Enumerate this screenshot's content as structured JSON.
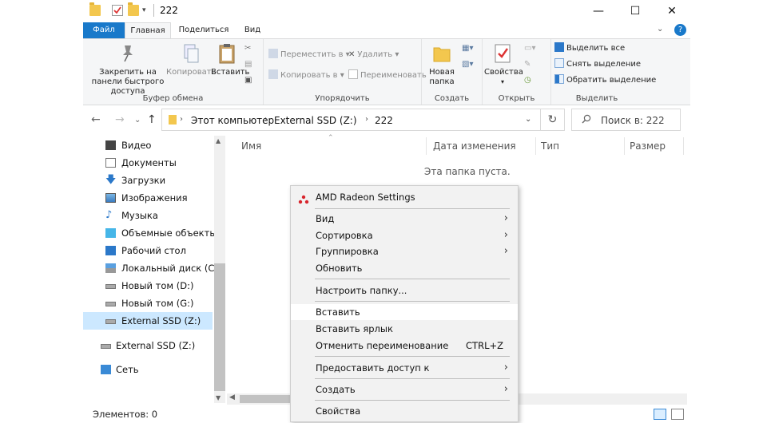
{
  "window": {
    "title": "222"
  },
  "ribbon_tabs": [
    "Файл",
    "Главная",
    "Поделиться",
    "Вид"
  ],
  "ribbon": {
    "clipboard": {
      "pin_label": "Закрепить на панели быстрого доступа",
      "copy_label": "Копировать",
      "paste_label": "Вставить",
      "group_label": "Буфер обмена"
    },
    "organize": {
      "move_label": "Переместить в",
      "copy_to_label": "Копировать в",
      "delete_label": "Удалить",
      "rename_label": "Переименовать",
      "group_label": "Упорядочить"
    },
    "create": {
      "new_folder_label": "Новая папка",
      "group_label": "Создать"
    },
    "open": {
      "properties_label": "Свойства",
      "group_label": "Открыть"
    },
    "select": {
      "select_all_label": "Выделить все",
      "select_none_label": "Снять выделение",
      "invert_label": "Обратить выделение",
      "group_label": "Выделить"
    }
  },
  "address": {
    "crumbs": [
      "Этот компьютер",
      "External SSD (Z:)",
      "222"
    ],
    "search_placeholder": "Поиск в: 222"
  },
  "nav_pane": {
    "items": [
      "Видео",
      "Документы",
      "Загрузки",
      "Изображения",
      "Музыка",
      "Объемные объекты",
      "Рабочий стол",
      "Локальный диск (C:)",
      "Новый том (D:)",
      "Новый том (G:)",
      "External SSD (Z:)",
      "External SSD (Z:)",
      "Сеть"
    ]
  },
  "content": {
    "columns": [
      "Имя",
      "Дата изменения",
      "Тип",
      "Размер"
    ],
    "empty_message": "Эта папка пуста."
  },
  "status": {
    "items_text": "Элементов: 0"
  },
  "context_menu": {
    "header": "AMD Radeon Settings",
    "items": [
      {
        "label": "Вид",
        "submenu": true
      },
      {
        "label": "Сортировка",
        "submenu": true
      },
      {
        "label": "Группировка",
        "submenu": true
      },
      {
        "label": "Обновить"
      },
      {
        "label": "Настроить папку..."
      },
      {
        "label": "Вставить"
      },
      {
        "label": "Вставить ярлык"
      },
      {
        "label": "Отменить переименование",
        "shortcut": "CTRL+Z"
      },
      {
        "label": "Предоставить доступ к",
        "submenu": true
      },
      {
        "label": "Создать",
        "submenu": true
      },
      {
        "label": "Свойства"
      }
    ]
  },
  "colors": {
    "accent": "#1979ca",
    "selection": "#cce8ff",
    "amd_red": "#d8242c",
    "folder": "#f3c74e"
  }
}
